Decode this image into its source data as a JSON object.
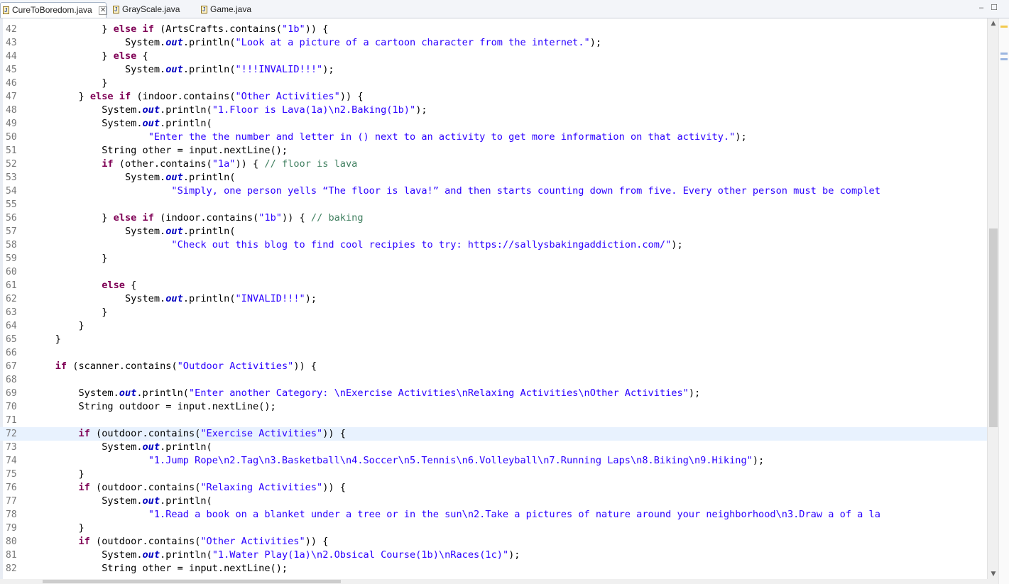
{
  "tabs": [
    {
      "label": "CureToBoredom.java",
      "active": true,
      "icon": "java-file-icon"
    },
    {
      "label": "GrayScale.java",
      "active": false,
      "icon": "java-file-icon"
    },
    {
      "label": "Game.java",
      "active": false,
      "icon": "java-file-icon"
    }
  ],
  "editor": {
    "current_line": 72,
    "lines": [
      {
        "n": "42",
        "tokens": [
          [
            "",
            "            } "
          ],
          [
            "kw",
            "else"
          ],
          [
            "",
            " "
          ],
          [
            "kw",
            "if"
          ],
          [
            "",
            " (ArtsCrafts.contains("
          ],
          [
            "str",
            "\"1b\""
          ],
          [
            "",
            ")) {"
          ]
        ]
      },
      {
        "n": "43",
        "tokens": [
          [
            "",
            "                System."
          ],
          [
            "fld",
            "out"
          ],
          [
            "",
            ".println("
          ],
          [
            "str",
            "\"Look at a picture of a cartoon character from the internet.\""
          ],
          [
            "",
            ");"
          ]
        ]
      },
      {
        "n": "44",
        "tokens": [
          [
            "",
            "            } "
          ],
          [
            "kw",
            "else"
          ],
          [
            "",
            " {"
          ]
        ]
      },
      {
        "n": "45",
        "tokens": [
          [
            "",
            "                System."
          ],
          [
            "fld",
            "out"
          ],
          [
            "",
            ".println("
          ],
          [
            "str",
            "\"!!!INVALID!!!\""
          ],
          [
            "",
            ");"
          ]
        ]
      },
      {
        "n": "46",
        "tokens": [
          [
            "",
            "            }"
          ]
        ]
      },
      {
        "n": "47",
        "tokens": [
          [
            "",
            "        } "
          ],
          [
            "kw",
            "else"
          ],
          [
            "",
            " "
          ],
          [
            "kw",
            "if"
          ],
          [
            "",
            " (indoor.contains("
          ],
          [
            "str",
            "\"Other Activities\""
          ],
          [
            "",
            ")) {"
          ]
        ]
      },
      {
        "n": "48",
        "tokens": [
          [
            "",
            "            System."
          ],
          [
            "fld",
            "out"
          ],
          [
            "",
            ".println("
          ],
          [
            "str",
            "\"1.Floor is Lava(1a)\\n2.Baking(1b)\""
          ],
          [
            "",
            ");"
          ]
        ]
      },
      {
        "n": "49",
        "tokens": [
          [
            "",
            "            System."
          ],
          [
            "fld",
            "out"
          ],
          [
            "",
            ".println("
          ]
        ]
      },
      {
        "n": "50",
        "tokens": [
          [
            "",
            "                    "
          ],
          [
            "str",
            "\"Enter the the number and letter in () next to an activity to get more information on that activity.\""
          ],
          [
            "",
            ");"
          ]
        ]
      },
      {
        "n": "51",
        "tokens": [
          [
            "",
            "            String other = input.nextLine();"
          ]
        ]
      },
      {
        "n": "52",
        "tokens": [
          [
            "",
            "            "
          ],
          [
            "kw",
            "if"
          ],
          [
            "",
            " (other.contains("
          ],
          [
            "str",
            "\"1a\""
          ],
          [
            "",
            ")) { "
          ],
          [
            "cmt",
            "// floor is lava"
          ]
        ]
      },
      {
        "n": "53",
        "tokens": [
          [
            "",
            "                System."
          ],
          [
            "fld",
            "out"
          ],
          [
            "",
            ".println("
          ]
        ]
      },
      {
        "n": "54",
        "tokens": [
          [
            "",
            "                        "
          ],
          [
            "str",
            "\"Simply, one person yells “The floor is lava!” and then starts counting down from five. Every other person must be complet"
          ]
        ]
      },
      {
        "n": "55",
        "tokens": [
          [
            "",
            ""
          ]
        ]
      },
      {
        "n": "56",
        "tokens": [
          [
            "",
            "            } "
          ],
          [
            "kw",
            "else"
          ],
          [
            "",
            " "
          ],
          [
            "kw",
            "if"
          ],
          [
            "",
            " (indoor.contains("
          ],
          [
            "str",
            "\"1b\""
          ],
          [
            "",
            ")) { "
          ],
          [
            "cmt",
            "// baking"
          ]
        ]
      },
      {
        "n": "57",
        "tokens": [
          [
            "",
            "                System."
          ],
          [
            "fld",
            "out"
          ],
          [
            "",
            ".println("
          ]
        ]
      },
      {
        "n": "58",
        "tokens": [
          [
            "",
            "                        "
          ],
          [
            "str",
            "\"Check out this blog to find cool recipies to try: https://sallysbakingaddiction.com/\""
          ],
          [
            "",
            ");"
          ]
        ]
      },
      {
        "n": "59",
        "tokens": [
          [
            "",
            "            }"
          ]
        ]
      },
      {
        "n": "60",
        "tokens": [
          [
            "",
            ""
          ]
        ]
      },
      {
        "n": "61",
        "tokens": [
          [
            "",
            "            "
          ],
          [
            "kw",
            "else"
          ],
          [
            "",
            " {"
          ]
        ]
      },
      {
        "n": "62",
        "tokens": [
          [
            "",
            "                System."
          ],
          [
            "fld",
            "out"
          ],
          [
            "",
            ".println("
          ],
          [
            "str",
            "\"INVALID!!!\""
          ],
          [
            "",
            ");"
          ]
        ]
      },
      {
        "n": "63",
        "tokens": [
          [
            "",
            "            }"
          ]
        ]
      },
      {
        "n": "64",
        "tokens": [
          [
            "",
            "        }"
          ]
        ]
      },
      {
        "n": "65",
        "tokens": [
          [
            "",
            "    }"
          ]
        ]
      },
      {
        "n": "66",
        "tokens": [
          [
            "",
            ""
          ]
        ]
      },
      {
        "n": "67",
        "tokens": [
          [
            "",
            "    "
          ],
          [
            "kw",
            "if"
          ],
          [
            "",
            " (scanner.contains("
          ],
          [
            "str",
            "\"Outdoor Activities\""
          ],
          [
            "",
            ")) {"
          ]
        ]
      },
      {
        "n": "68",
        "tokens": [
          [
            "",
            ""
          ]
        ]
      },
      {
        "n": "69",
        "tokens": [
          [
            "",
            "        System."
          ],
          [
            "fld",
            "out"
          ],
          [
            "",
            ".println("
          ],
          [
            "str",
            "\"Enter another Category: \\nExercise Activities\\nRelaxing Activities\\nOther Activities\""
          ],
          [
            "",
            ");"
          ]
        ]
      },
      {
        "n": "70",
        "tokens": [
          [
            "",
            "        String outdoor = input.nextLine();"
          ]
        ]
      },
      {
        "n": "71",
        "tokens": [
          [
            "",
            ""
          ]
        ]
      },
      {
        "n": "72",
        "tokens": [
          [
            "",
            "        "
          ],
          [
            "kw",
            "if"
          ],
          [
            "",
            " (outdoor.contains("
          ],
          [
            "str",
            "\"Exercise Activities\""
          ],
          [
            "",
            ")) {"
          ]
        ]
      },
      {
        "n": "73",
        "tokens": [
          [
            "",
            "            System."
          ],
          [
            "fld",
            "out"
          ],
          [
            "",
            ".println("
          ]
        ]
      },
      {
        "n": "74",
        "tokens": [
          [
            "",
            "                    "
          ],
          [
            "str",
            "\"1.Jump Rope\\n2.Tag\\n3.Basketball\\n4.Soccer\\n5.Tennis\\n6.Volleyball\\n7.Running Laps\\n8.Biking\\n9.Hiking\""
          ],
          [
            "",
            ");"
          ]
        ]
      },
      {
        "n": "75",
        "tokens": [
          [
            "",
            "        }"
          ]
        ]
      },
      {
        "n": "76",
        "tokens": [
          [
            "",
            "        "
          ],
          [
            "kw",
            "if"
          ],
          [
            "",
            " (outdoor.contains("
          ],
          [
            "str",
            "\"Relaxing Activities\""
          ],
          [
            "",
            ")) {"
          ]
        ]
      },
      {
        "n": "77",
        "tokens": [
          [
            "",
            "            System."
          ],
          [
            "fld",
            "out"
          ],
          [
            "",
            ".println("
          ]
        ]
      },
      {
        "n": "78",
        "tokens": [
          [
            "",
            "                    "
          ],
          [
            "str",
            "\"1.Read a book on a blanket under a tree or in the sun\\n2.Take a pictures of nature around your neighborhood\\n3.Draw a of a la"
          ]
        ]
      },
      {
        "n": "79",
        "tokens": [
          [
            "",
            "        }"
          ]
        ]
      },
      {
        "n": "80",
        "tokens": [
          [
            "",
            "        "
          ],
          [
            "kw",
            "if"
          ],
          [
            "",
            " (outdoor.contains("
          ],
          [
            "str",
            "\"Other Activities\""
          ],
          [
            "",
            ")) {"
          ]
        ]
      },
      {
        "n": "81",
        "tokens": [
          [
            "",
            "            System."
          ],
          [
            "fld",
            "out"
          ],
          [
            "",
            ".println("
          ],
          [
            "str",
            "\"1.Water Play(1a)\\n2.Obsical Course(1b)\\nRaces(1c)\""
          ],
          [
            "",
            ");"
          ]
        ]
      },
      {
        "n": "82",
        "tokens": [
          [
            "",
            "            String other = input.nextLine();"
          ]
        ]
      }
    ]
  },
  "colors": {
    "keyword": "#7f0055",
    "string": "#2a00ff",
    "field": "#0000c0",
    "comment": "#3f7f5f",
    "current_line": "#e8f2fe"
  },
  "window_controls": {
    "minimize": "–",
    "maximize": "☐"
  }
}
